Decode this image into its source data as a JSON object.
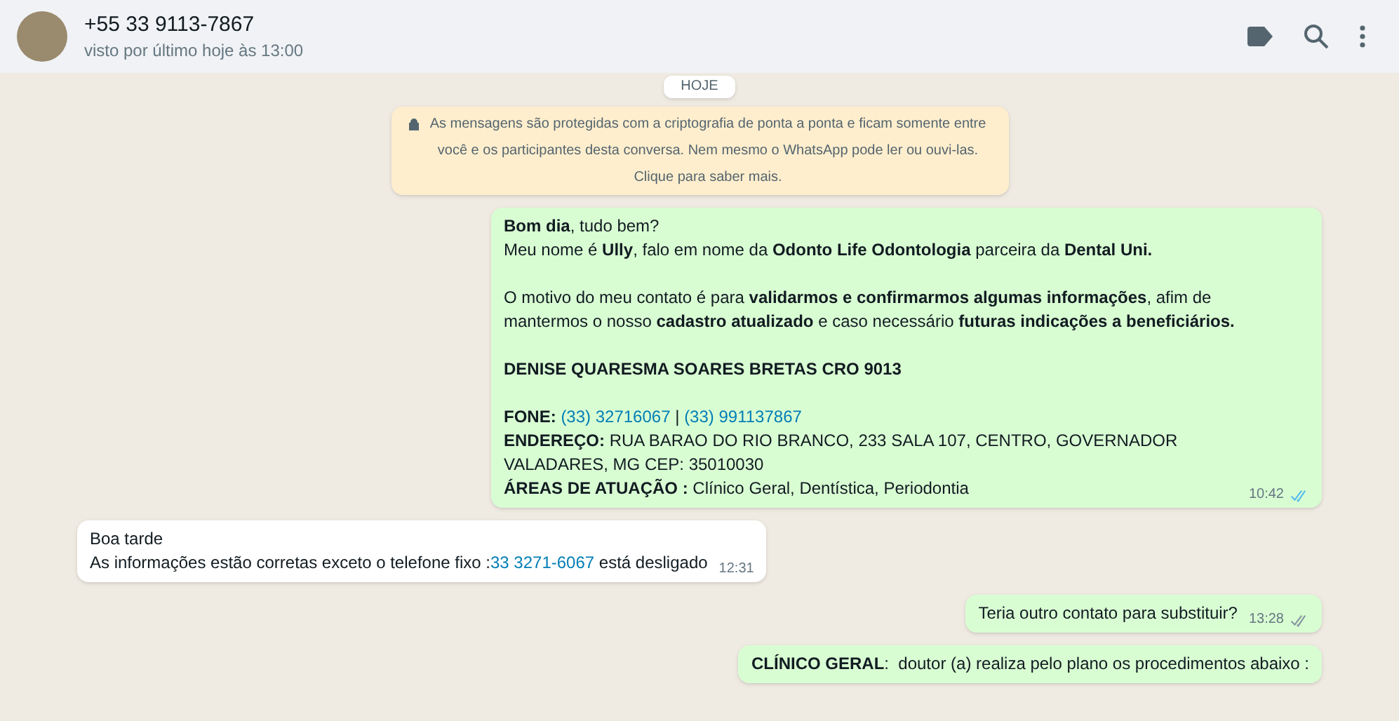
{
  "header": {
    "name": "+55 33 9113-7867",
    "status": "visto por último hoje às 13:00"
  },
  "date_chip": "HOJE",
  "notice": "As mensagens são protegidas com a criptografia de ponta a ponta e ficam somente entre você e os participantes desta conversa. Nem mesmo o WhatsApp pode ler ou ouvi-las. Clique para saber mais.",
  "messages": [
    {
      "kind": "outgoing",
      "time": "10:42",
      "read": true,
      "paragraphs": [
        [
          [
            {
              "kind": "text",
              "text": "**Bom dia**, tudo bem?"
            }
          ],
          [
            {
              "kind": "text",
              "text": "Meu nome é **Ully**, falo em nome da **Odonto Life Odontologia** parceira da **Dental Uni.**"
            }
          ]
        ],
        [
          [
            {
              "kind": "text",
              "text": "O motivo do meu contato é para **validarmos e confirmarmos algumas informações**, afim de mantermos o nosso **cadastro atualizado** e caso necessário **futuras indicações a beneficiários.**"
            }
          ]
        ],
        [
          [
            {
              "kind": "text",
              "text": "**DENISE QUARESMA SOARES BRETAS CRO 9013**"
            }
          ]
        ],
        [
          [
            {
              "kind": "text",
              "text": "**FONE:** "
            },
            {
              "kind": "link",
              "text": "(33) 32716067"
            },
            {
              "kind": "text",
              "text": " | "
            },
            {
              "kind": "link",
              "text": "(33) 991137867"
            }
          ],
          [
            {
              "kind": "text",
              "text": "**ENDEREÇO:** RUA BARAO DO RIO BRANCO, 233 SALA 107, CENTRO, GOVERNADOR VALADARES, MG CEP: 35010030"
            }
          ],
          [
            {
              "kind": "text",
              "text": "**ÁREAS DE ATUAÇÃO :** Clínico Geral, Dentística, Periodontia"
            }
          ]
        ]
      ]
    },
    {
      "kind": "incoming",
      "time": "12:31",
      "paragraphs": [
        [
          [
            {
              "kind": "text",
              "text": "Boa tarde"
            }
          ],
          [
            {
              "kind": "text",
              "text": "As informações estão corretas exceto o telefone fixo :"
            },
            {
              "kind": "link",
              "text": "33 3271-6067"
            },
            {
              "kind": "text",
              "text": " está desligado"
            }
          ]
        ]
      ]
    },
    {
      "kind": "outgoing",
      "time": "13:28",
      "read": false,
      "paragraphs": [
        [
          [
            {
              "kind": "text",
              "text": "Teria outro contato para substituir?"
            }
          ]
        ]
      ]
    },
    {
      "kind": "outgoing",
      "paragraphs": [
        [
          [
            {
              "kind": "text",
              "text": "**CLÍNICO GERAL**:  doutor (a) realiza pelo plano os procedimentos abaixo :"
            }
          ]
        ]
      ]
    }
  ]
}
